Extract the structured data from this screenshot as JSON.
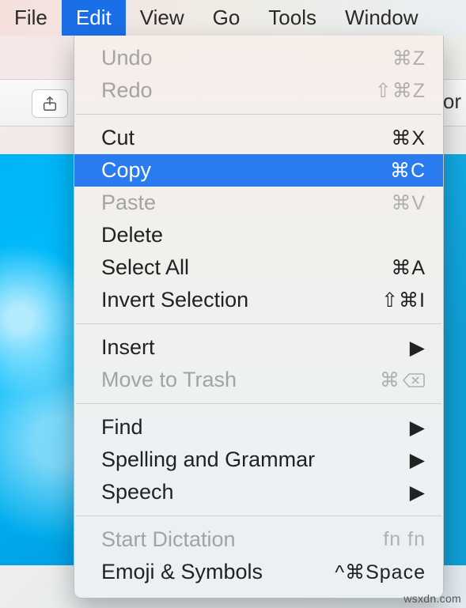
{
  "menubar": {
    "items": [
      {
        "label": "File"
      },
      {
        "label": "Edit"
      },
      {
        "label": "View"
      },
      {
        "label": "Go"
      },
      {
        "label": "Tools"
      },
      {
        "label": "Window"
      }
    ],
    "active_index": 1
  },
  "toolbar": {
    "truncated_text": "cor"
  },
  "edit_menu": {
    "groups": [
      [
        {
          "id": "undo",
          "label": "Undo",
          "shortcut": "⌘Z",
          "disabled": true
        },
        {
          "id": "redo",
          "label": "Redo",
          "shortcut": "⇧⌘Z",
          "disabled": true
        }
      ],
      [
        {
          "id": "cut",
          "label": "Cut",
          "shortcut": "⌘X"
        },
        {
          "id": "copy",
          "label": "Copy",
          "shortcut": "⌘C",
          "highlighted": true
        },
        {
          "id": "paste",
          "label": "Paste",
          "shortcut": "⌘V",
          "disabled": true
        },
        {
          "id": "delete",
          "label": "Delete"
        },
        {
          "id": "select-all",
          "label": "Select All",
          "shortcut": "⌘A"
        },
        {
          "id": "invert-selection",
          "label": "Invert Selection",
          "shortcut": "⇧⌘I"
        }
      ],
      [
        {
          "id": "insert",
          "label": "Insert",
          "submenu": true
        },
        {
          "id": "move-to-trash",
          "label": "Move to Trash",
          "shortcut": "⌘",
          "disabled": true,
          "trailing_icon": "delete-key-icon"
        }
      ],
      [
        {
          "id": "find",
          "label": "Find",
          "submenu": true
        },
        {
          "id": "spelling-grammar",
          "label": "Spelling and Grammar",
          "submenu": true
        },
        {
          "id": "speech",
          "label": "Speech",
          "submenu": true
        }
      ],
      [
        {
          "id": "start-dictation",
          "label": "Start Dictation",
          "shortcut": "fn fn",
          "disabled": true
        },
        {
          "id": "emoji-symbols",
          "label": "Emoji & Symbols",
          "shortcut": "^⌘Space"
        }
      ]
    ]
  },
  "watermark": "wsxdn.com"
}
